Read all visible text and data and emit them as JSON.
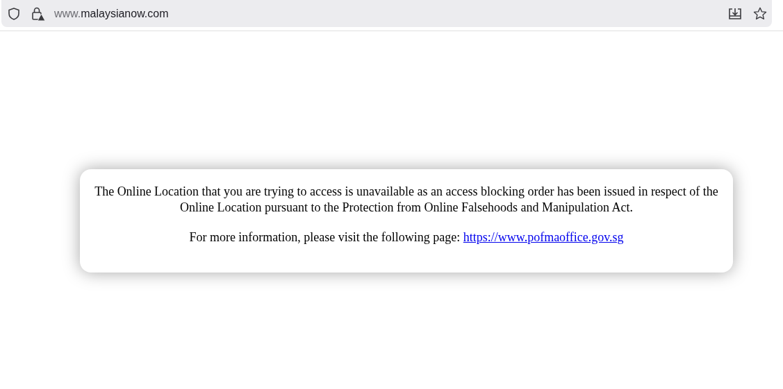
{
  "address_bar": {
    "url_prefix": "www.",
    "url_domain": "malaysianow.com"
  },
  "notice": {
    "message": "The Online Location that you are trying to access is unavailable as an access blocking order has been issued in respect of the Online Location pursuant to the Protection from Online Falsehoods and Manipulation Act.",
    "info_text": "For more information, please visit the following page:",
    "link": "https://www.pofmaoffice.gov.sg"
  }
}
